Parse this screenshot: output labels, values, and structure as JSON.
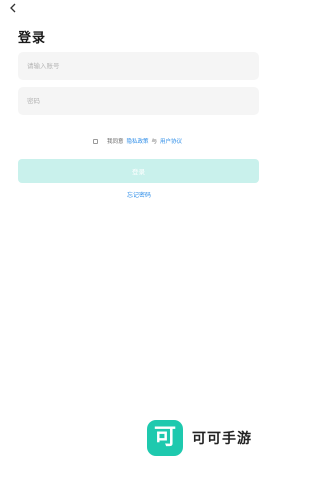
{
  "header": {
    "back_icon": "chevron-left-icon",
    "title": "登录"
  },
  "form": {
    "account_placeholder": "请输入账号",
    "account_value": "",
    "password_placeholder": "密码",
    "password_value": ""
  },
  "agreement": {
    "checked": false,
    "prefix": "我同意",
    "privacy_link": "隐私政策",
    "connector": "与",
    "terms_link": "用户协议"
  },
  "login_button_label": "登录",
  "forgot_password_label": "忘记密码",
  "watermark": {
    "logo_char": "可",
    "text": "可可手游"
  },
  "colors": {
    "accent": "#1ec9ae",
    "button_disabled": "#c9f1ec",
    "link": "#2f8ee8",
    "field_bg": "#f5f5f5"
  }
}
